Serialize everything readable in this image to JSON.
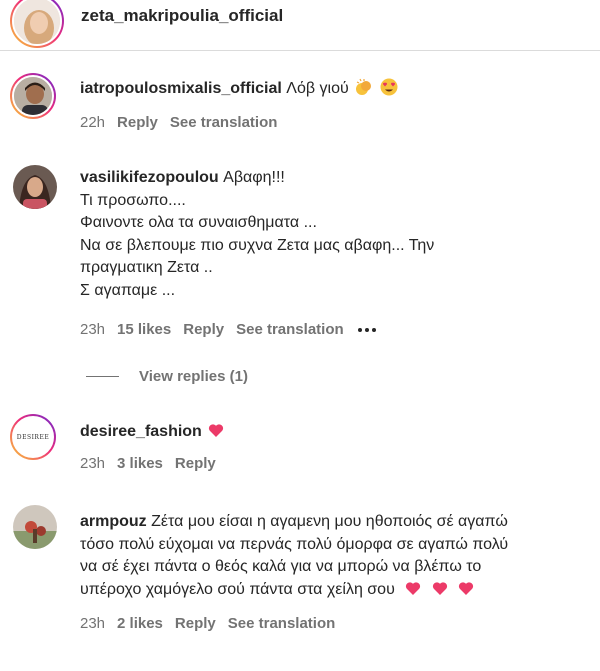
{
  "header": {
    "username": "zeta_makripoulia_official"
  },
  "comments": [
    {
      "username": "iatropoulosmixalis_official",
      "text": "Λόβ γιού",
      "emojis": [
        "clapping-hands-icon",
        "heart-eyes-icon"
      ],
      "time": "22h",
      "likes": "",
      "reply_label": "Reply",
      "translation_label": "See translation"
    },
    {
      "username": "vasilikifezopoulou",
      "lines": [
        "Αβαφη!!!",
        "Τι προσωπο....",
        "Φαινοντε ολα τα συναισθηματα ...",
        "Να σε βλεπουμε πιο συχνα Ζετα μας αβαφη... Την",
        "πραγματικη Ζετα ..",
        "Σ αγαπαμε ..."
      ],
      "time": "23h",
      "likes": "15 likes",
      "reply_label": "Reply",
      "translation_label": "See translation",
      "view_replies": "View replies (1)"
    },
    {
      "username": "desiree_fashion",
      "avatar_text": "DESIREE",
      "emojis": [
        "pink-heart-icon"
      ],
      "time": "23h",
      "likes": "3 likes",
      "reply_label": "Reply"
    },
    {
      "username": "armpouz",
      "first_line": "Ζέτα μου είσαι η αγαμενη μου ηθοποιός σέ αγαπώ",
      "lines": [
        "τόσο πολύ εύχομαι να περνάς πολύ όμορφα σε αγαπώ πολύ",
        "να σέ έχει πάντα ο θεός καλά για να μπορώ να βλέπω το",
        "υπέροχο χαμόγελο σού πάντα στα χείλη σου"
      ],
      "emojis": [
        "pink-heart-icon",
        "pink-heart-icon",
        "pink-heart-icon"
      ],
      "time": "23h",
      "likes": "2 likes",
      "reply_label": "Reply",
      "translation_label": "See translation"
    }
  ],
  "colors": {
    "text_primary": "#262626",
    "text_secondary": "#737373",
    "heart_pink": "#f0386b",
    "divider": "#dbdbdb"
  }
}
